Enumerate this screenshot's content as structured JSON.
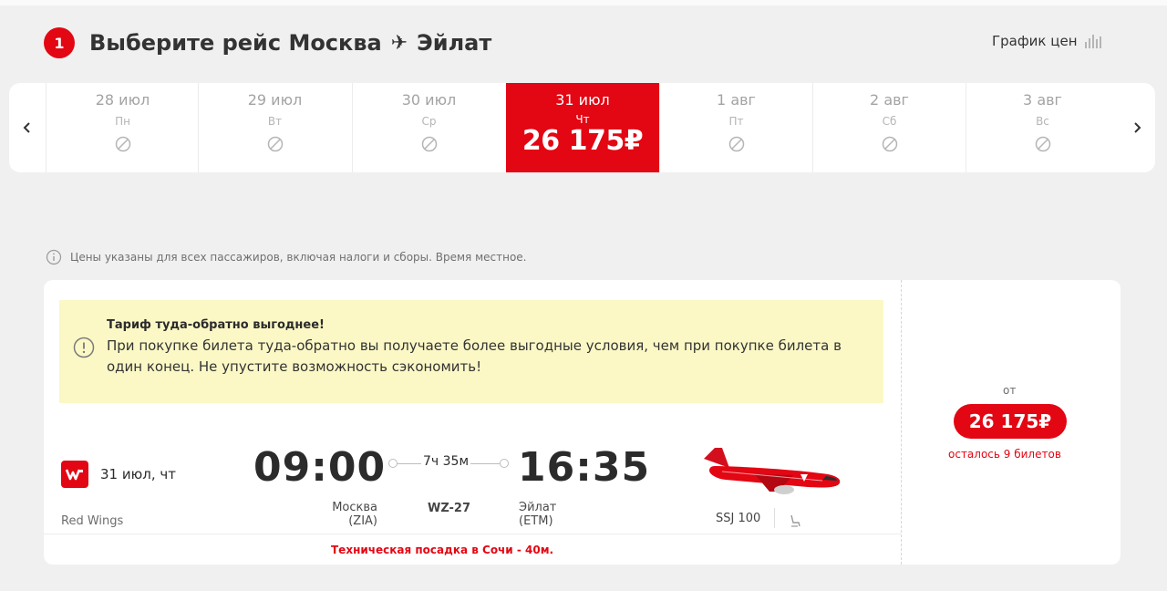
{
  "header": {
    "step": "1",
    "title_prefix": "Выберите рейс",
    "origin": "Москва",
    "plane_glyph": "✈",
    "destination": "Эйлат",
    "price_chart_label": "График цен",
    "price_chart_icon": "bar-chart-icon"
  },
  "dates": {
    "prev_icon": "chevron-left-icon",
    "next_icon": "chevron-right-icon",
    "days": [
      {
        "date": "28 июл",
        "weekday": "Пн",
        "available": false
      },
      {
        "date": "29 июл",
        "weekday": "Вт",
        "available": false
      },
      {
        "date": "30 июл",
        "weekday": "Ср",
        "available": false
      },
      {
        "date": "31 июл",
        "weekday": "Чт",
        "available": true,
        "price": "26 175₽",
        "selected": true
      },
      {
        "date": "1 авг",
        "weekday": "Пт",
        "available": false
      },
      {
        "date": "2 авг",
        "weekday": "Сб",
        "available": false
      },
      {
        "date": "3 авг",
        "weekday": "Вс",
        "available": false
      }
    ]
  },
  "info_note": "Цены указаны для всех пассажиров, включая налоги и сборы. Время местное.",
  "promo": {
    "title": "Тариф туда-обратно выгоднее!",
    "body": "При покупке билета туда-обратно вы получаете более выгодные условия, чем при покупке билета в один конец. Не упустите возможность сэкономить!"
  },
  "flight": {
    "date": "31 июл, чт",
    "airline": "Red Wings",
    "departure_time": "09:00",
    "arrival_time": "16:35",
    "duration": "7ч 35м",
    "departure_city": "Москва",
    "departure_code": "(ZIA)",
    "arrival_city": "Эйлат",
    "arrival_code": "(ETM)",
    "flight_number": "WZ-27",
    "aircraft": "SSJ 100",
    "technical_stop": "Техническая посадка в Сочи - 40м."
  },
  "price": {
    "from_label": "от",
    "value": "26 175₽",
    "seats_left": "осталось 9 билетов"
  },
  "colors": {
    "accent": "#e30613",
    "promo_bg": "#fbf8c6",
    "page_bg": "#f0f0f0"
  }
}
